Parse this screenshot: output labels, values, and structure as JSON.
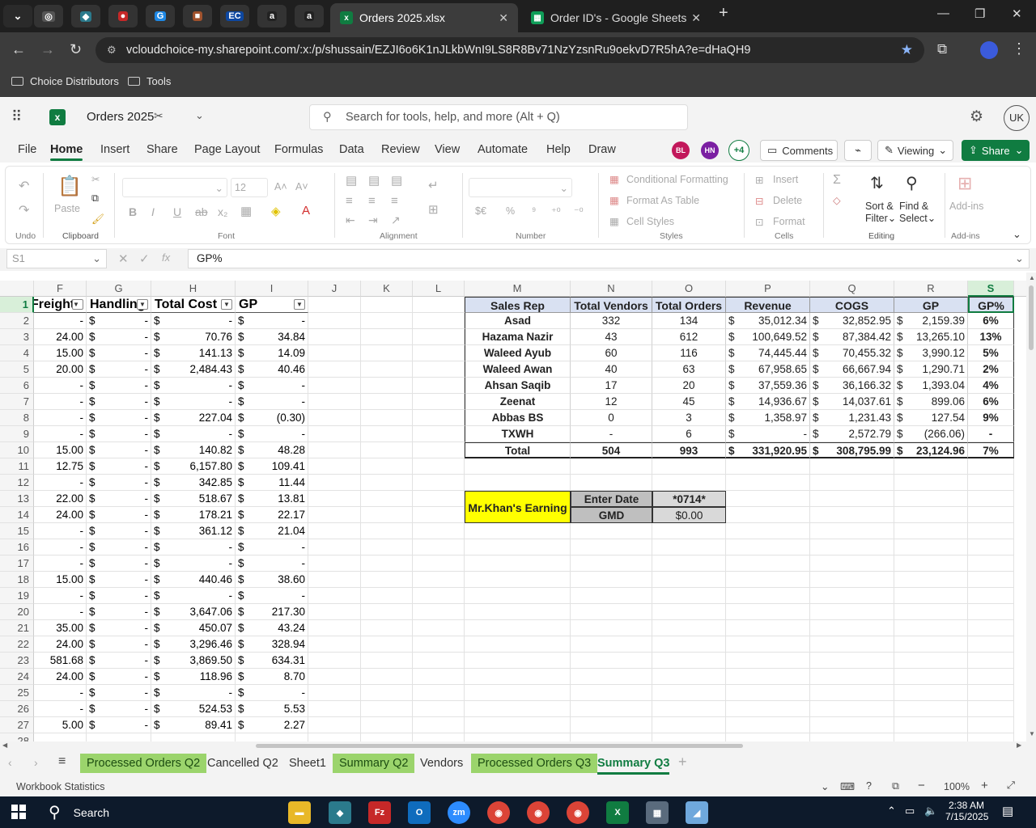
{
  "browser": {
    "pinned_tabs": [
      {
        "icon": "chrome-settings-icon",
        "glyph": "◎",
        "color": "#555555"
      },
      {
        "icon": "app-diamond-icon",
        "glyph": "◆",
        "color": "#2b7a8c"
      },
      {
        "icon": "red-app-icon",
        "glyph": "●",
        "color": "#c62828"
      },
      {
        "icon": "g-app-icon",
        "glyph": "G",
        "color": "#1e88e5"
      },
      {
        "icon": "box-app-icon",
        "glyph": "■",
        "color": "#a0522d"
      },
      {
        "icon": "ec-app-icon",
        "glyph": "EC",
        "color": "#0d47a1"
      },
      {
        "icon": "amazon-icon",
        "glyph": "a",
        "color": "#222222"
      },
      {
        "icon": "amazon-icon-2",
        "glyph": "a",
        "color": "#222222"
      }
    ],
    "tabs": [
      {
        "title": "Orders 2025.xlsx",
        "active": true
      },
      {
        "title": "Order ID's - Google Sheets",
        "active": false
      }
    ],
    "url": "vcloudchoice-my.sharepoint.com/:x:/p/shussain/EZJI6o6K1nJLkbWnI9LS8R8Bv71NzYzsnRu9oekvD7R5hA?e=dHaQH9",
    "bookmarks": [
      "Choice Distributors",
      "Tools"
    ]
  },
  "excel": {
    "file_name": "Orders 2025",
    "search_placeholder": "Search for tools, help, and more (Alt + Q)",
    "user_initials": "UK",
    "menu": [
      "File",
      "Home",
      "Insert",
      "Share",
      "Page Layout",
      "Formulas",
      "Data",
      "Review",
      "View",
      "Automate",
      "Help",
      "Draw"
    ],
    "active_menu": "Home",
    "collaborators": [
      {
        "initials": "BL",
        "color": "#c2185b"
      },
      {
        "initials": "HN",
        "color": "#7b1fa2"
      }
    ],
    "extra_collaborators": "+4",
    "comments_label": "Comments",
    "viewing_label": "Viewing",
    "share_label": "Share",
    "ribbon": {
      "undo_group": "Undo",
      "paste_label": "Paste",
      "clipboard_group": "Clipboard",
      "font_size": "12",
      "font_group": "Font",
      "alignment_group": "Alignment",
      "number_group": "Number",
      "conditional_formatting": "Conditional Formatting",
      "format_as_table": "Format As Table",
      "cell_styles": "Cell Styles",
      "styles_group": "Styles",
      "insert": "Insert",
      "delete": "Delete",
      "format": "Format",
      "cells_group": "Cells",
      "sort_filter_1": "Sort &",
      "sort_filter_2": "Filter",
      "find_select_1": "Find &",
      "find_select_2": "Select",
      "editing_group": "Editing",
      "addins": "Add-ins",
      "addins_group": "Add-ins"
    },
    "name_box": "S1",
    "formula": "GP%",
    "columns": [
      "F",
      "G",
      "H",
      "I",
      "J",
      "K",
      "L",
      "M",
      "N",
      "O",
      "P",
      "Q",
      "R",
      "S"
    ],
    "selected_column": "S",
    "left_headers": [
      "Freight",
      "Handling",
      "Total Cost",
      "GP"
    ],
    "rows": [
      {
        "r": 2,
        "f": "-",
        "h": "-",
        "tc": "-",
        "gp": "-"
      },
      {
        "r": 3,
        "f": "24.00",
        "h": "-",
        "tc": "70.76",
        "gp": "34.84"
      },
      {
        "r": 4,
        "f": "15.00",
        "h": "-",
        "tc": "141.13",
        "gp": "14.09"
      },
      {
        "r": 5,
        "f": "20.00",
        "h": "-",
        "tc": "2,484.43",
        "gp": "40.46"
      },
      {
        "r": 6,
        "f": "-",
        "h": "-",
        "tc": "-",
        "gp": "-"
      },
      {
        "r": 7,
        "f": "-",
        "h": "-",
        "tc": "-",
        "gp": "-"
      },
      {
        "r": 8,
        "f": "-",
        "h": "-",
        "tc": "227.04",
        "gp": "(0.30)"
      },
      {
        "r": 9,
        "f": "-",
        "h": "-",
        "tc": "-",
        "gp": "-"
      },
      {
        "r": 10,
        "f": "15.00",
        "h": "-",
        "tc": "140.82",
        "gp": "48.28"
      },
      {
        "r": 11,
        "f": "12.75",
        "h": "-",
        "tc": "6,157.80",
        "gp": "109.41"
      },
      {
        "r": 12,
        "f": "-",
        "h": "-",
        "tc": "342.85",
        "gp": "11.44"
      },
      {
        "r": 13,
        "f": "22.00",
        "h": "-",
        "tc": "518.67",
        "gp": "13.81"
      },
      {
        "r": 14,
        "f": "24.00",
        "h": "-",
        "tc": "178.21",
        "gp": "22.17"
      },
      {
        "r": 15,
        "f": "-",
        "h": "-",
        "tc": "361.12",
        "gp": "21.04"
      },
      {
        "r": 16,
        "f": "-",
        "h": "-",
        "tc": "-",
        "gp": "-"
      },
      {
        "r": 17,
        "f": "-",
        "h": "-",
        "tc": "-",
        "gp": "-"
      },
      {
        "r": 18,
        "f": "15.00",
        "h": "-",
        "tc": "440.46",
        "gp": "38.60"
      },
      {
        "r": 19,
        "f": "-",
        "h": "-",
        "tc": "-",
        "gp": "-"
      },
      {
        "r": 20,
        "f": "-",
        "h": "-",
        "tc": "3,647.06",
        "gp": "217.30"
      },
      {
        "r": 21,
        "f": "35.00",
        "h": "-",
        "tc": "450.07",
        "gp": "43.24"
      },
      {
        "r": 22,
        "f": "24.00",
        "h": "-",
        "tc": "3,296.46",
        "gp": "328.94"
      },
      {
        "r": 23,
        "f": "581.68",
        "h": "-",
        "tc": "3,869.50",
        "gp": "634.31"
      },
      {
        "r": 24,
        "f": "24.00",
        "h": "-",
        "tc": "118.96",
        "gp": "8.70"
      },
      {
        "r": 25,
        "f": "-",
        "h": "-",
        "tc": "-",
        "gp": "-"
      },
      {
        "r": 26,
        "f": "-",
        "h": "-",
        "tc": "524.53",
        "gp": "5.53"
      },
      {
        "r": 27,
        "f": "5.00",
        "h": "-",
        "tc": "89.41",
        "gp": "2.27"
      }
    ],
    "summary_headers": [
      "Sales Rep",
      "Total Vendors",
      "Total Orders",
      "Revenue",
      "COGS",
      "GP",
      "GP%"
    ],
    "summary_rows": [
      {
        "rep": "Asad",
        "vendors": "332",
        "orders": "134",
        "revenue": "35,012.34",
        "cogs": "32,852.95",
        "gp": "2,159.39",
        "gpp": "6%"
      },
      {
        "rep": "Hazama Nazir",
        "vendors": "43",
        "orders": "612",
        "revenue": "100,649.52",
        "cogs": "87,384.42",
        "gp": "13,265.10",
        "gpp": "13%"
      },
      {
        "rep": "Waleed Ayub",
        "vendors": "60",
        "orders": "116",
        "revenue": "74,445.44",
        "cogs": "70,455.32",
        "gp": "3,990.12",
        "gpp": "5%"
      },
      {
        "rep": "Waleed Awan",
        "vendors": "40",
        "orders": "63",
        "revenue": "67,958.65",
        "cogs": "66,667.94",
        "gp": "1,290.71",
        "gpp": "2%"
      },
      {
        "rep": "Ahsan Saqib",
        "vendors": "17",
        "orders": "20",
        "revenue": "37,559.36",
        "cogs": "36,166.32",
        "gp": "1,393.04",
        "gpp": "4%"
      },
      {
        "rep": "Zeenat",
        "vendors": "12",
        "orders": "45",
        "revenue": "14,936.67",
        "cogs": "14,037.61",
        "gp": "899.06",
        "gpp": "6%"
      },
      {
        "rep": "Abbas BS",
        "vendors": "0",
        "orders": "3",
        "revenue": "1,358.97",
        "cogs": "1,231.43",
        "gp": "127.54",
        "gpp": "9%"
      },
      {
        "rep": "TXWH",
        "vendors": "-",
        "orders": "6",
        "revenue": "-",
        "cogs": "2,572.79",
        "gp": "(266.06)",
        "gpp": "-"
      }
    ],
    "summary_total": {
      "rep": "Total",
      "vendors": "504",
      "orders": "993",
      "revenue": "331,920.95",
      "cogs": "308,795.99",
      "gp": "23,124.96",
      "gpp": "7%"
    },
    "earning_box": {
      "title": "Mr.Khan's Earning",
      "date_label": "Enter Date",
      "date_value": "*0714*",
      "gmd_label": "GMD",
      "gmd_value": "$0.00"
    },
    "sheet_tabs": [
      {
        "name": "Processed Orders Q2",
        "green": true,
        "active": false
      },
      {
        "name": "Cancelled Q2",
        "green": false,
        "active": false
      },
      {
        "name": "Sheet1",
        "green": false,
        "active": false
      },
      {
        "name": "Summary Q2",
        "green": true,
        "active": false
      },
      {
        "name": "Vendors",
        "green": false,
        "active": false
      },
      {
        "name": "Processed Orders Q3",
        "green": true,
        "active": false
      },
      {
        "name": "Summary Q3",
        "green": false,
        "active": true
      }
    ],
    "status_left": "Workbook Statistics",
    "zoom": "100%"
  },
  "taskbar": {
    "search_label": "Search",
    "time": "2:38 AM",
    "date": "7/15/2025"
  }
}
